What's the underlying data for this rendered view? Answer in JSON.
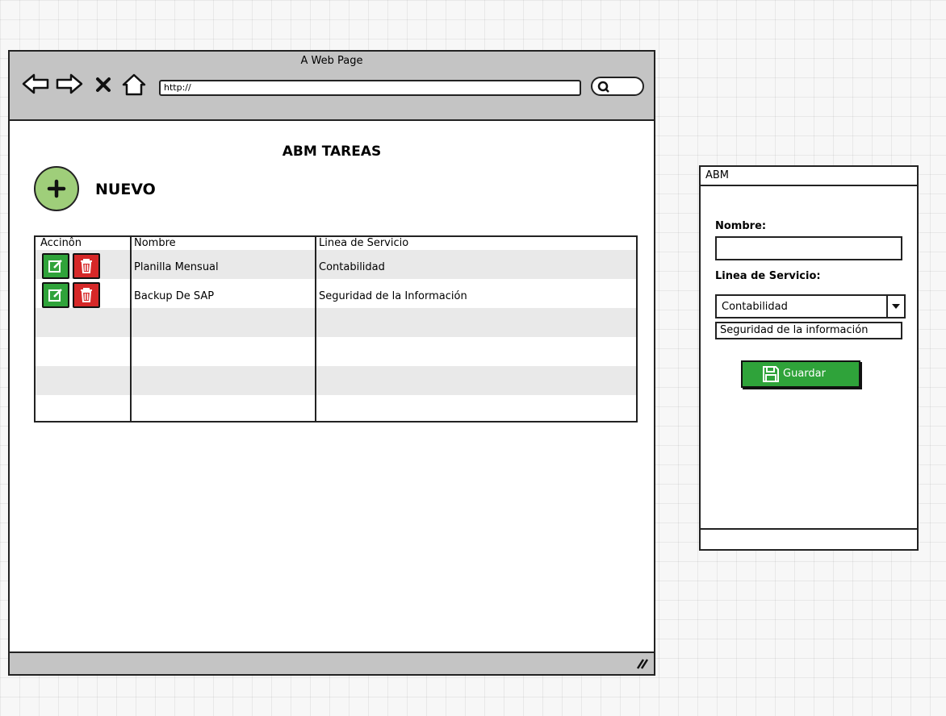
{
  "browser": {
    "window_title": "A Web Page",
    "url": "http://",
    "icons": [
      "back-arrow-icon",
      "forward-arrow-icon",
      "close-icon",
      "home-icon",
      "search-icon",
      "resize-grip-icon"
    ]
  },
  "page": {
    "title": "ABM TAREAS",
    "new_label": "NUEVO"
  },
  "table": {
    "headers": {
      "action": "Accinôn",
      "name": "Nombre",
      "service_line": "Linea de Servicio"
    },
    "rows": [
      {
        "name": "Planilla Mensual",
        "service_line": "Contabilidad"
      },
      {
        "name": "Backup De SAP",
        "service_line": "Seguridad de la Información"
      }
    ]
  },
  "abm_form": {
    "title": "ABM",
    "name_label": "Nombre:",
    "name_value": "",
    "service_label": "Linea de Servicio:",
    "service_selected": "Contabilidad",
    "service_option": "Seguridad de la información",
    "save_label": "Guardar"
  },
  "colors": {
    "add_button": "#9fce7a",
    "edit_button": "#2fa33a",
    "delete_button": "#d62828",
    "save_button": "#2fa33a",
    "toolbar": "#c4c4c4"
  }
}
